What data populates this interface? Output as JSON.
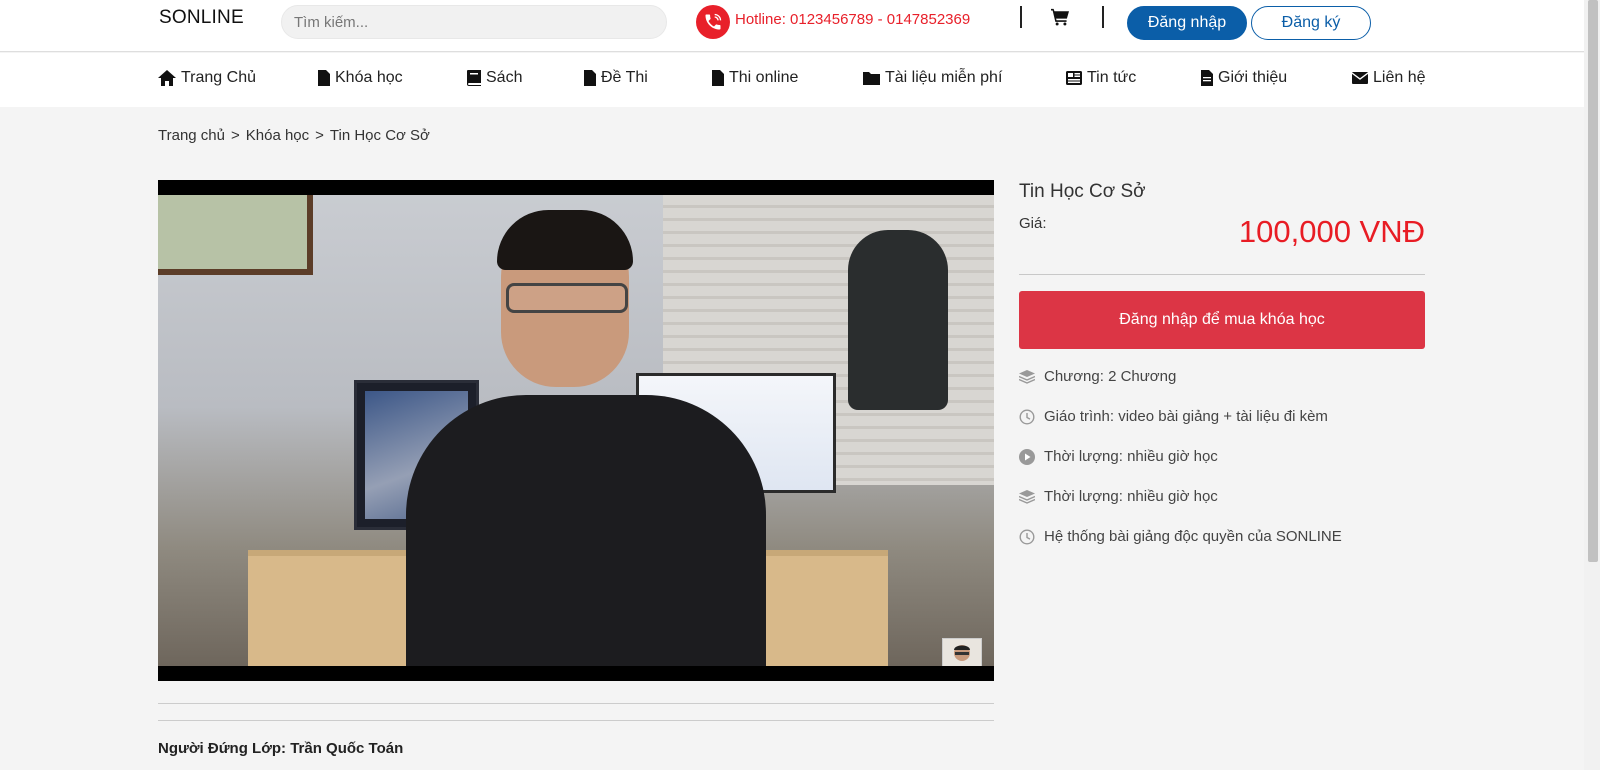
{
  "header": {
    "brand": "SONLINE",
    "search_placeholder": "Tìm kiếm...",
    "hotline": "Hotline: 0123456789 - 0147852369",
    "login_label": "Đăng nhập",
    "register_label": "Đăng ký"
  },
  "nav": {
    "items": [
      {
        "label": "Trang Chủ",
        "icon": "home-icon"
      },
      {
        "label": "Khóa học",
        "icon": "file-icon"
      },
      {
        "label": "Sách",
        "icon": "book-icon"
      },
      {
        "label": "Đề Thi",
        "icon": "file-icon"
      },
      {
        "label": "Thi online",
        "icon": "file-icon"
      },
      {
        "label": "Tài liệu miễn phí",
        "icon": "folder-icon"
      },
      {
        "label": "Tin tức",
        "icon": "newspaper-icon"
      },
      {
        "label": "Giới thiệu",
        "icon": "file-text-icon"
      },
      {
        "label": "Liên hệ",
        "icon": "envelope-icon"
      }
    ]
  },
  "breadcrumb": {
    "items": [
      "Trang chủ",
      "Khóa học",
      "Tin Học Cơ Sở"
    ],
    "separator": ">"
  },
  "course": {
    "title": "Tin Học Cơ Sở",
    "price_label": "Giá:",
    "price": "100,000 VNĐ",
    "buy_label": "Đăng nhập để mua khóa học",
    "features": [
      {
        "icon": "layers-icon",
        "text": "Chương: 2 Chương"
      },
      {
        "icon": "clock-icon",
        "text": "Giáo trình: video bài giảng + tài liệu đi kèm"
      },
      {
        "icon": "play-circle-icon",
        "text": "Thời lượng: nhiều giờ học"
      },
      {
        "icon": "layers-icon",
        "text": "Thời lượng: nhiều giờ học"
      },
      {
        "icon": "clock-icon",
        "text": "Hệ thống bài giảng độc quyền của SONLINE"
      }
    ],
    "instructor": "Người Đứng Lớp: Trần Quốc Toán"
  },
  "colors": {
    "brand_blue": "#0b5ea8",
    "accent_red": "#e81c24",
    "buy_button": "#dc3545"
  }
}
